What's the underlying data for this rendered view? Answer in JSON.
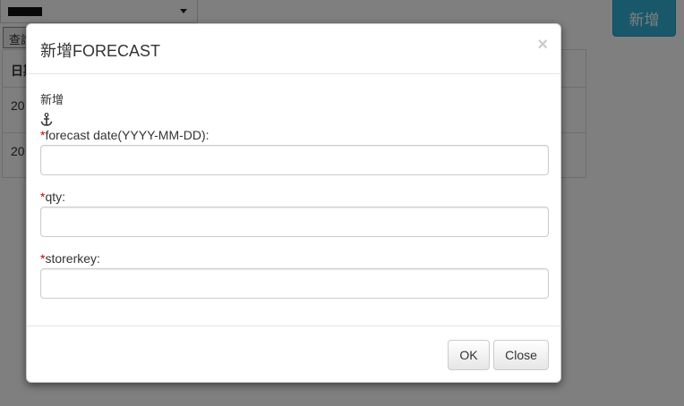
{
  "background": {
    "query_button_label": "查詢",
    "add_button_label": "新增",
    "table": {
      "header_first_cell": "日期",
      "rows": [
        "20",
        "20"
      ]
    }
  },
  "modal": {
    "title": "新增FORECAST",
    "close_symbol": "×",
    "subtitle": "新增",
    "anchor_icon": "anchor-icon",
    "required_marker": "*",
    "fields": [
      {
        "label": "forecast date(YYYY-MM-DD):",
        "value": "",
        "placeholder": ""
      },
      {
        "label": "qty:",
        "value": "",
        "placeholder": ""
      },
      {
        "label": "storerkey:",
        "value": "",
        "placeholder": ""
      }
    ],
    "buttons": {
      "ok": "OK",
      "close": "Close"
    }
  },
  "colors": {
    "required": "#cc0000",
    "primary_info": "#31b0d5",
    "backdrop": "rgba(0,0,0,0.5)"
  }
}
